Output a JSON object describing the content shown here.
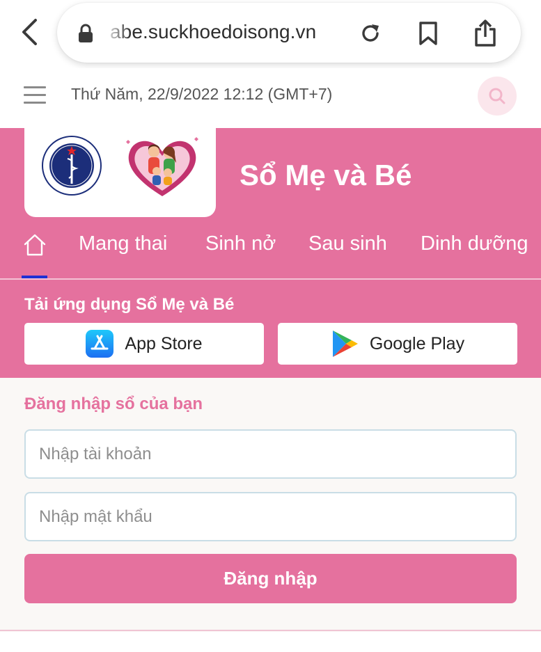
{
  "browser": {
    "url": "abe.suckhoedoisong.vn",
    "icons": [
      "back-icon",
      "lock-icon",
      "reload-icon",
      "bookmark-icon",
      "share-icon"
    ]
  },
  "topbar": {
    "date": "Thứ Năm, 22/9/2022 12:12 (GMT+7)",
    "icons": [
      "menu-icon",
      "search-icon"
    ]
  },
  "header": {
    "title": "Sổ Mẹ và Bé",
    "logos": [
      "ministry-of-health-logo",
      "family-heart-logo"
    ],
    "logo_text": "BỘ Y TẾ · MINISTRY OF HEALTH"
  },
  "nav": {
    "items": [
      {
        "label": "Mang thai"
      },
      {
        "label": "Sinh nở"
      },
      {
        "label": "Sau sinh"
      },
      {
        "label": "Dinh dưỡng"
      }
    ]
  },
  "app_download": {
    "title": "Tải ứng dụng Sổ Mẹ và Bé",
    "app_store_label": "App Store",
    "google_play_label": "Google Play"
  },
  "login": {
    "title": "Đăng nhập sổ của bạn",
    "username_placeholder": "Nhập tài khoản",
    "password_placeholder": "Nhập mật khẩu",
    "submit_label": "Đăng nhập"
  },
  "colors": {
    "brand_pink": "#e5719e",
    "active_tab_indicator": "#1f2fd4",
    "background": "#faf8f6"
  }
}
